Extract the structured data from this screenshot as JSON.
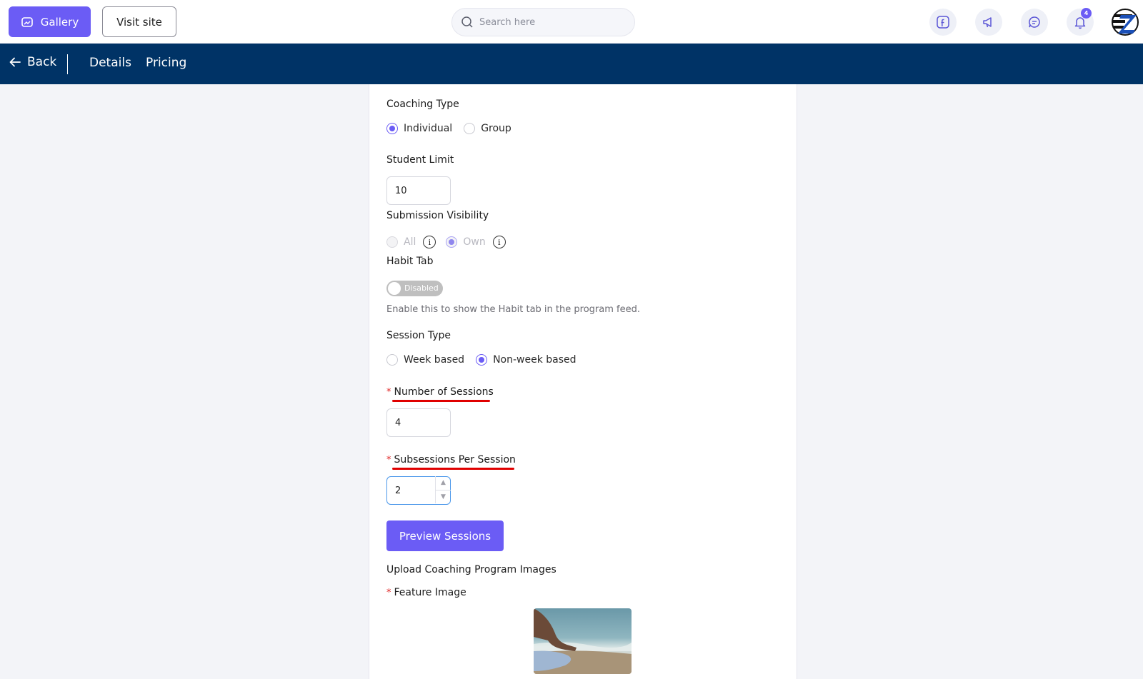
{
  "topbar": {
    "gallery_label": "Gallery",
    "visit_site_label": "Visit site",
    "search_placeholder": "Search here",
    "notification_count": "4",
    "icons": [
      "facebook-icon",
      "megaphone-icon",
      "chat-icon",
      "bell-icon"
    ]
  },
  "navbar": {
    "back_label": "Back",
    "tabs": [
      {
        "label": "Details"
      },
      {
        "label": "Pricing"
      }
    ]
  },
  "form": {
    "coaching_type": {
      "label": "Coaching Type",
      "options": [
        {
          "label": "Individual",
          "selected": true
        },
        {
          "label": "Group",
          "selected": false
        }
      ]
    },
    "student_limit": {
      "label": "Student Limit",
      "value": "10"
    },
    "submission_visibility": {
      "label": "Submission Visibility",
      "options": [
        {
          "label": "All",
          "selected": false
        },
        {
          "label": "Own",
          "selected": true
        }
      ],
      "info_glyph": "i"
    },
    "habit_tab": {
      "label": "Habit Tab",
      "toggle_state": "Disabled",
      "hint": "Enable this to show the Habit tab in the program feed."
    },
    "session_type": {
      "label": "Session Type",
      "options": [
        {
          "label": "Week based",
          "selected": false
        },
        {
          "label": "Non-week based",
          "selected": true
        }
      ]
    },
    "number_of_sessions": {
      "required_mark": "*",
      "label": "Number of Sessions",
      "value": "4"
    },
    "subsessions_per_session": {
      "required_mark": "*",
      "label": "Subsessions Per Session",
      "value": "2"
    },
    "preview_button_label": "Preview Sessions",
    "upload_heading": "Upload Coaching Program Images",
    "feature_image": {
      "required_mark": "*",
      "label": "Feature Image"
    }
  },
  "colors": {
    "accent": "#6b5cf5",
    "navbar": "#003366",
    "required": "#e02424",
    "annotation_underline": "#e00000"
  }
}
